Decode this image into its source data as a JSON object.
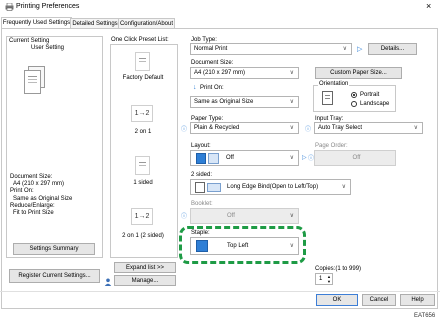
{
  "window": {
    "title": "Printing Preferences",
    "close": "×"
  },
  "tabs": [
    {
      "label": "Frequently Used Settings"
    },
    {
      "label": "Detailed Settings"
    },
    {
      "label": "Configuration/About"
    }
  ],
  "current_setting": {
    "heading": "Current Setting",
    "preset_name": "User Setting",
    "summary_lines": [
      "Document Size:",
      "  A4 (210 x 297 mm)",
      "Print On:",
      "  Same as Original Size",
      "Reduce/Enlarge:",
      "  Fit to Print Size"
    ],
    "summary_button": "Settings Summary"
  },
  "register_button": "Register Current Settings...",
  "presets": {
    "heading": "One Click Preset List:",
    "items": [
      {
        "label": "Factory Default",
        "icon": ""
      },
      {
        "label": "2 on 1",
        "icon": "1→2"
      },
      {
        "label": "1 sided",
        "icon": ""
      },
      {
        "label": "2 on 1 (2 sided)",
        "icon": "1→2"
      }
    ],
    "expand_button": "Expand list >>",
    "manage_button": "Manage..."
  },
  "job_type": {
    "label": "Job Type:",
    "value": "Normal Print",
    "details_button": "Details..."
  },
  "document_size": {
    "label": "Document Size:",
    "value": "A4 (210 x 297 mm)"
  },
  "custom_size_button": "Custom Paper Size...",
  "orientation": {
    "label": "Orientation",
    "portrait": "Portrait",
    "landscape": "Landscape",
    "selected": "Portrait"
  },
  "print_on": {
    "label": "Print On:",
    "value": "Same as Original Size"
  },
  "paper_type": {
    "label": "Paper Type:",
    "value": "Plain & Recycled"
  },
  "input_tray": {
    "label": "Input Tray:",
    "value": "Auto Tray Select"
  },
  "layout": {
    "label": "Layout:",
    "value": "Off"
  },
  "page_order": {
    "label": "Page Order:",
    "value": "Off"
  },
  "two_sided": {
    "label": "2 sided:",
    "value": "Long Edge Bind(Open to Left/Top)"
  },
  "booklet": {
    "label": "Booklet:",
    "value": "Off"
  },
  "staple": {
    "label": "Staple:",
    "value": "Top Left"
  },
  "copies": {
    "label": "Copies:(1 to 999)",
    "value": "1"
  },
  "footer": {
    "ok": "OK",
    "cancel": "Cancel",
    "help": "Help"
  },
  "figure_code": "EAT656",
  "colors": {
    "highlight": "#1e9b45",
    "info": "#2f7fd6"
  }
}
